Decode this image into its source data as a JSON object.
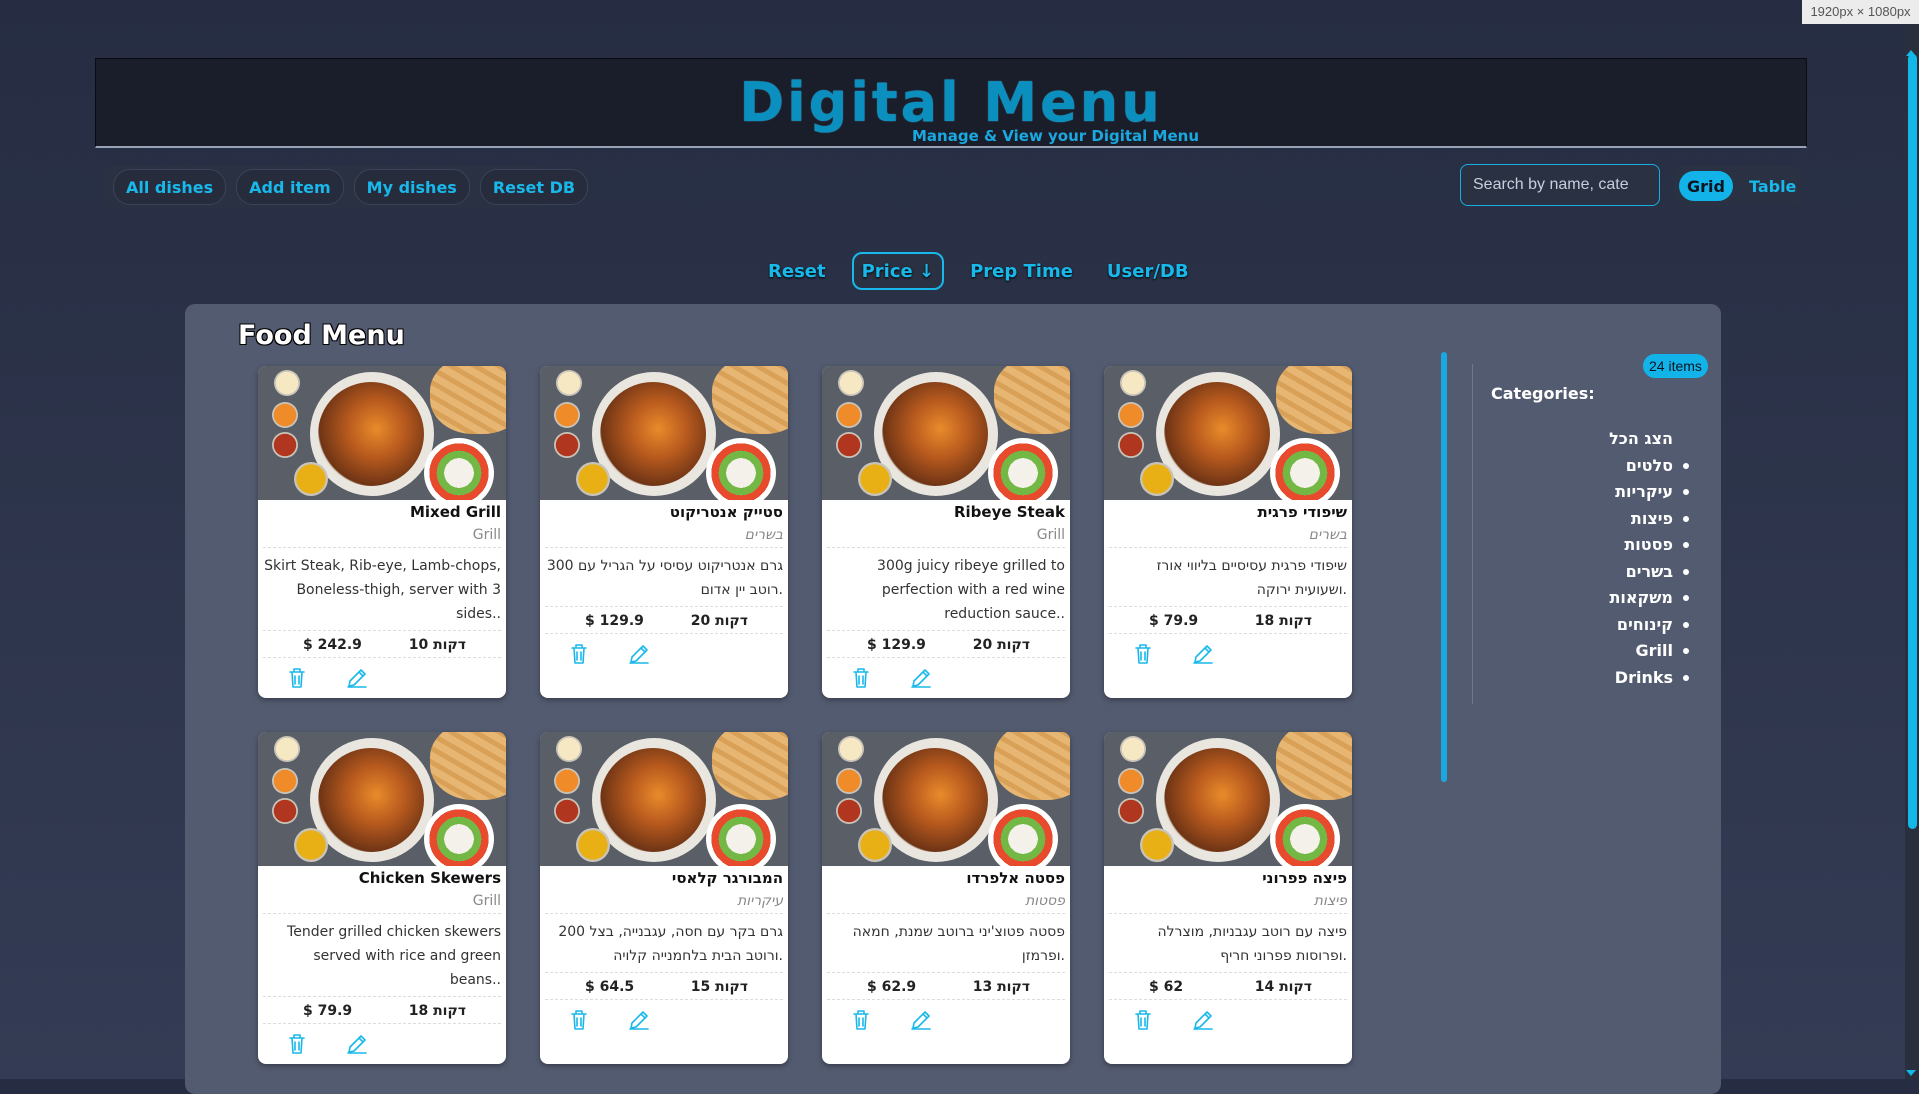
{
  "screen_size_label": "1920px × 1080px",
  "header": {
    "title": "Digital Menu",
    "subtitle": "Manage & View your Digital Menu"
  },
  "nav": {
    "items": [
      "All dishes",
      "Add item",
      "My dishes",
      "Reset DB"
    ]
  },
  "search": {
    "placeholder": "Search by name, cate"
  },
  "view_toggle": {
    "options": [
      "Grid",
      "Table"
    ],
    "active": "Grid"
  },
  "sort": {
    "options": [
      "Reset",
      "Price ↓",
      "Prep Time",
      "User/DB"
    ],
    "active": "Price ↓"
  },
  "panel": {
    "title": "Food Menu"
  },
  "cards": [
    {
      "name": "Mixed Grill",
      "category": "Grill",
      "category_hebrew": false,
      "description": "Skirt Steak, Rib-eye, Lamb-chops, Boneless-thigh, server with 3 sides..",
      "time": "10 דקות",
      "price": "$ 242.9"
    },
    {
      "name": "סטייק אנטריקוט",
      "category": "בשרים",
      "category_hebrew": true,
      "description": "300 גרם אנטריקוט עסיסי על הגריל עם רוטב יין אדום.",
      "time": "20 דקות",
      "price": "$ 129.9"
    },
    {
      "name": "Ribeye Steak",
      "category": "Grill",
      "category_hebrew": false,
      "description": "300g juicy ribeye grilled to perfection with a red wine reduction sauce..",
      "time": "20 דקות",
      "price": "$ 129.9"
    },
    {
      "name": "שיפודי פרגית",
      "category": "בשרים",
      "category_hebrew": true,
      "description": "שיפודי פרגית עסיסיים בליווי אורז ושעועית ירוקה.",
      "time": "18 דקות",
      "price": "$ 79.9"
    },
    {
      "name": "Chicken Skewers",
      "category": "Grill",
      "category_hebrew": false,
      "description": "Tender grilled chicken skewers served with rice and green beans..",
      "time": "18 דקות",
      "price": "$ 79.9"
    },
    {
      "name": "המבורגר קלאסי",
      "category": "עיקריות",
      "category_hebrew": true,
      "description": "200 גרם בקר עם חסה, עגבנייה, בצל ורוטב הבית בלחמנייה קלויה.",
      "time": "15 דקות",
      "price": "$ 64.5"
    },
    {
      "name": "פסטה אלפרדו",
      "category": "פסטות",
      "category_hebrew": true,
      "description": "פסטה פטוצ'יני ברוטב שמנת, חמאה ופרמזן.",
      "time": "13 דקות",
      "price": "$ 62.9"
    },
    {
      "name": "פיצה פפרוני",
      "category": "פיצות",
      "category_hebrew": true,
      "description": "פיצה עם רוטב עגבניות, מוצרלה ופרוסות פפרוני חריף.",
      "time": "14 דקות",
      "price": "$ 62"
    }
  ],
  "sidebar": {
    "items_badge": "24 items",
    "categories_title": "Categories:",
    "show_all": "הצג הכל",
    "categories": [
      "סלטים",
      "עיקריות",
      "פיצות",
      "פסטות",
      "בשרים",
      "משקאות",
      "קינוחים",
      "Grill",
      "Drinks"
    ]
  },
  "colors": {
    "accent": "#11b3e8",
    "title": "#0b8fbf",
    "panel": "#535b70",
    "background": "#2b3248"
  }
}
